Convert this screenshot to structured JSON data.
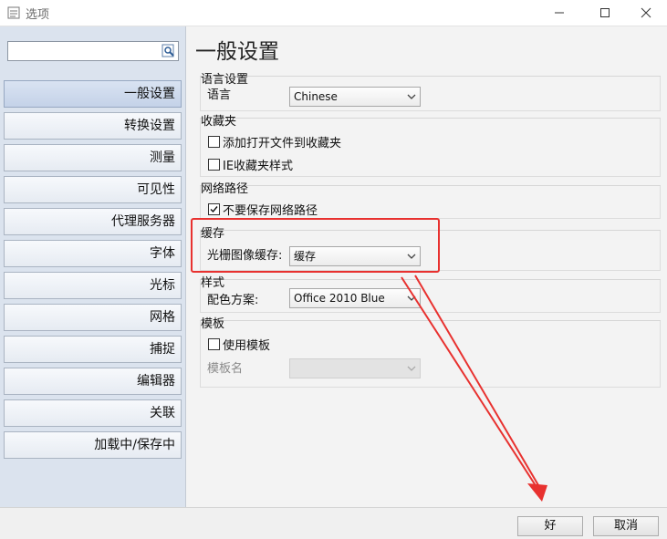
{
  "window": {
    "title": "选项"
  },
  "sidebar": {
    "search": {
      "value": "",
      "placeholder": ""
    },
    "items": [
      {
        "label": "一般设置",
        "active": true
      },
      {
        "label": "转换设置"
      },
      {
        "label": "测量"
      },
      {
        "label": "可见性"
      },
      {
        "label": "代理服务器"
      },
      {
        "label": "字体"
      },
      {
        "label": "光标"
      },
      {
        "label": "网格"
      },
      {
        "label": "捕捉"
      },
      {
        "label": "编辑器"
      },
      {
        "label": "关联"
      },
      {
        "label": "加载中/保存中"
      }
    ]
  },
  "main": {
    "title": "一般设置",
    "language": {
      "group_label": "语言设置",
      "field_label": "语言",
      "value": "Chinese"
    },
    "favorites": {
      "group_label": "收藏夹",
      "add_open_files": {
        "label": "添加打开文件到收藏夹",
        "checked": false
      },
      "ie_style": {
        "label": "IE收藏夹样式",
        "checked": false
      }
    },
    "network": {
      "group_label": "网络路径",
      "dont_save": {
        "label": "不要保存网络路径",
        "checked": true
      }
    },
    "cache": {
      "group_label": "缓存",
      "field_label": "光栅图像缓存:",
      "value": "缓存"
    },
    "style": {
      "group_label": "样式",
      "field_label": "配色方案:",
      "value": "Office 2010 Blue"
    },
    "template": {
      "group_label": "模板",
      "use_template": {
        "label": "使用模板",
        "checked": false
      },
      "name_label": "模板名",
      "name_value": ""
    }
  },
  "footer": {
    "ok_label": "好",
    "cancel_label": "取消"
  },
  "colors": {
    "annotation_red": "#e8312f",
    "sidebar_bg": "#dbe3ee"
  }
}
